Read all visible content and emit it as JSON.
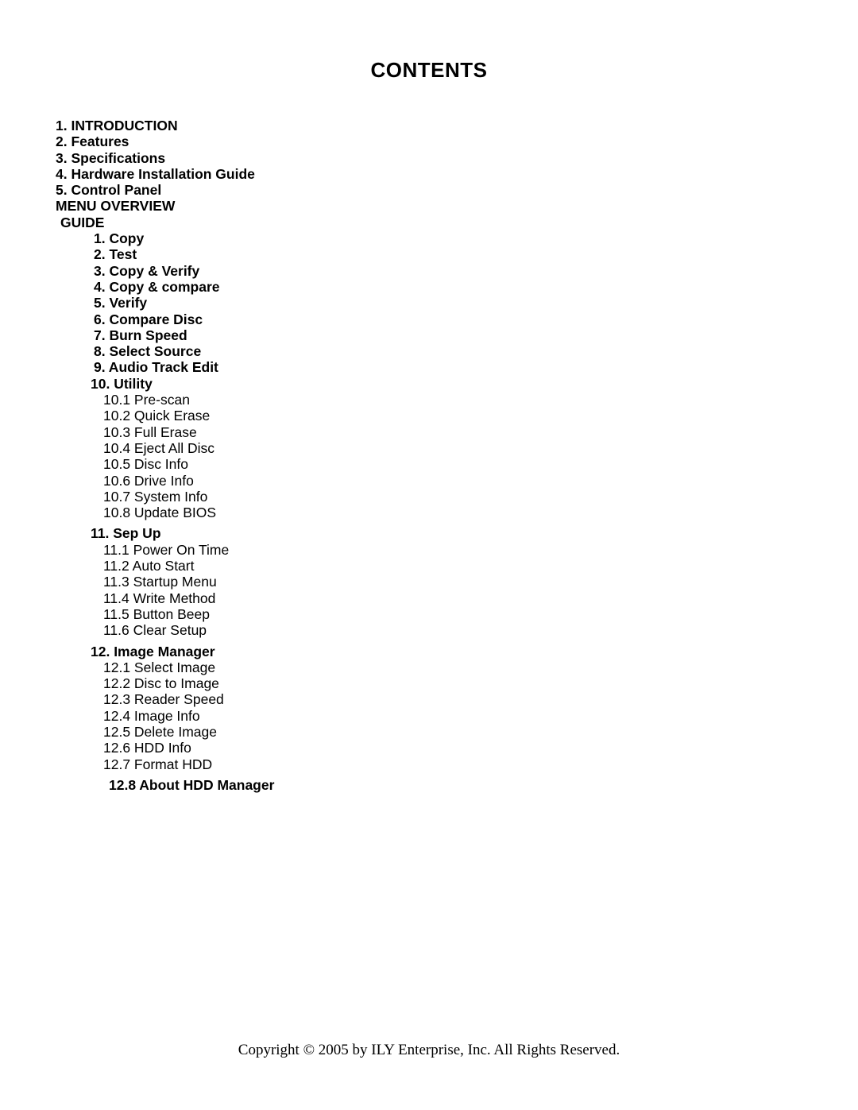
{
  "document": {
    "title": "CONTENTS",
    "footer": "Copyright © 2005 by ILY Enterprise, Inc. All Rights Reserved."
  },
  "contents": {
    "entries": [
      {
        "text": "1. INTRODUCTION",
        "level": "top"
      },
      {
        "text": "2. Features",
        "level": "top"
      },
      {
        "text": "3. Specifications",
        "level": "top"
      },
      {
        "text": "4. Hardware Installation Guide",
        "level": "top"
      },
      {
        "text": "5. Control Panel",
        "level": "top"
      },
      {
        "text": "MENU OVERVIEW",
        "level": "section"
      },
      {
        "text": "GUIDE",
        "level": "sectionb"
      },
      {
        "text": "1. Copy",
        "level": "menu"
      },
      {
        "text": "2. Test",
        "level": "menu"
      },
      {
        "text": "3. Copy & Verify",
        "level": "menu"
      },
      {
        "text": "4. Copy & compare",
        "level": "menu"
      },
      {
        "text": "5. Verify",
        "level": "menu"
      },
      {
        "text": "6. Compare Disc",
        "level": "menu"
      },
      {
        "text": "7. Burn Speed",
        "level": "menu"
      },
      {
        "text": "8. Select Source",
        "level": "menu"
      },
      {
        "text": "9. Audio Track Edit",
        "level": "menu"
      },
      {
        "text": "10. Utility",
        "level": "menu-w"
      },
      {
        "text": "10.1 Pre-scan",
        "level": "sub"
      },
      {
        "text": "10.2 Quick Erase",
        "level": "sub"
      },
      {
        "text": "10.3 Full Erase",
        "level": "sub"
      },
      {
        "text": "10.4 Eject All Disc",
        "level": "sub"
      },
      {
        "text": "10.5 Disc Info",
        "level": "sub"
      },
      {
        "text": "10.6 Drive Info",
        "level": "sub"
      },
      {
        "text": "10.7 System Info",
        "level": "sub"
      },
      {
        "text": "10.8 Update BIOS",
        "level": "sub"
      },
      {
        "text": "11. Sep Up",
        "level": "menu-w",
        "gap": true
      },
      {
        "text": "11.1 Power On Time",
        "level": "sub"
      },
      {
        "text": "11.2 Auto Start",
        "level": "sub"
      },
      {
        "text": "11.3 Startup Menu",
        "level": "sub"
      },
      {
        "text": "11.4 Write Method",
        "level": "sub"
      },
      {
        "text": "11.5 Button Beep",
        "level": "sub"
      },
      {
        "text": "11.6 Clear Setup",
        "level": "sub"
      },
      {
        "text": "12. Image Manager",
        "level": "menu-w",
        "gap": true
      },
      {
        "text": "12.1 Select Image",
        "level": "sub"
      },
      {
        "text": "12.2 Disc to Image",
        "level": "sub"
      },
      {
        "text": "12.3 Reader Speed",
        "level": "sub"
      },
      {
        "text": "12.4 Image Info",
        "level": "sub"
      },
      {
        "text": "12.5 Delete Image",
        "level": "sub"
      },
      {
        "text": "12.6 HDD Info",
        "level": "sub"
      },
      {
        "text": "12.7 Format HDD",
        "level": "sub"
      },
      {
        "text": "12.8 About HDD Manager",
        "level": "sub-b",
        "gap": true
      }
    ]
  }
}
